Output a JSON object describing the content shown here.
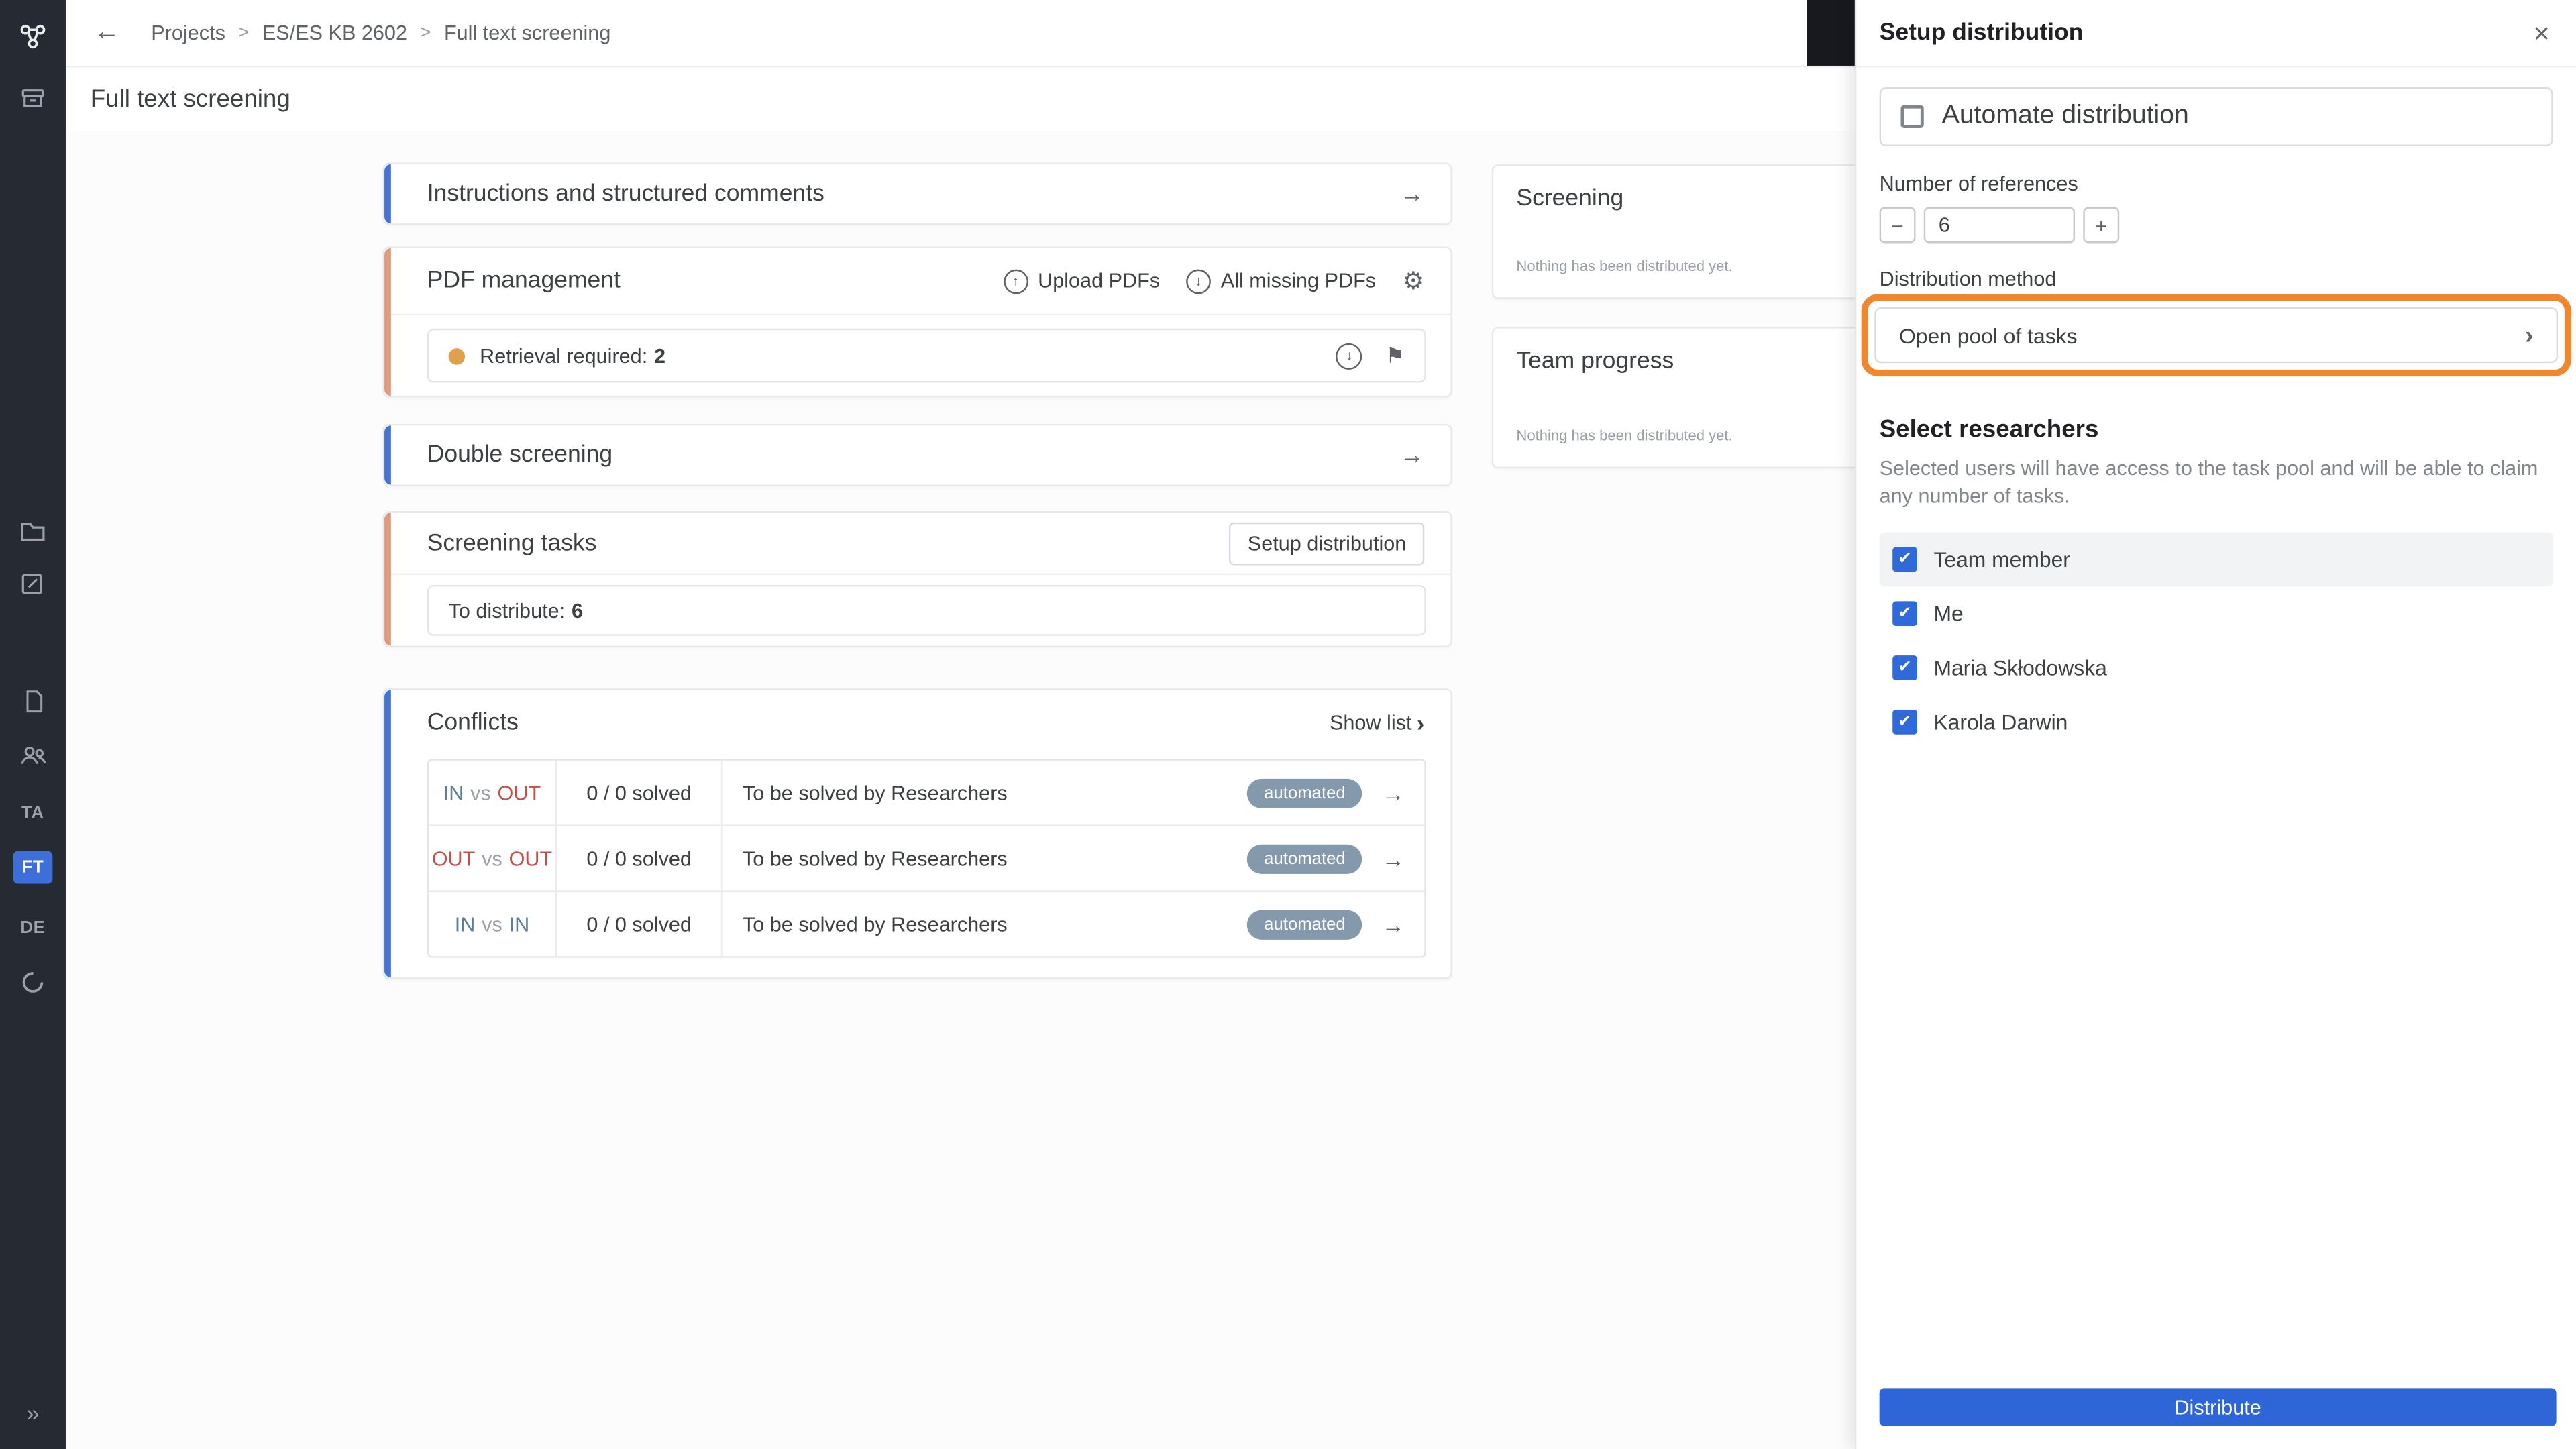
{
  "ui": {
    "back_arrow": "←",
    "arrow": "→",
    "chevron": "›",
    "crumb_sep": ">",
    "check": "✔",
    "up": "↑",
    "down": "↓",
    "gear": "⚙",
    "flag": "⚑",
    "close": "×",
    "minus": "−",
    "plus": "+",
    "expand": "»"
  },
  "sidebar": {
    "icons": [
      "app-logo",
      "archive-icon",
      "folder-icon",
      "edit-icon",
      "document-icon",
      "team-icon",
      "sync-icon",
      "expand-icon"
    ],
    "labels": {
      "ta": "TA",
      "ft": "FT",
      "de": "DE"
    }
  },
  "topbar": {
    "breadcrumb": [
      "Projects",
      "ES/ES KB 2602",
      "Full text screening"
    ]
  },
  "page": {
    "title": "Full text screening"
  },
  "cards": {
    "instructions": {
      "title": "Instructions and structured comments"
    },
    "pdf_management": {
      "title": "PDF management",
      "upload_label": "Upload PDFs",
      "missing_label": "All missing PDFs",
      "retrieval_label": "Retrieval required:",
      "retrieval_count": "2"
    },
    "double_screening": {
      "title": "Double screening"
    },
    "screening_tasks": {
      "title": "Screening tasks",
      "setup_button": "Setup distribution",
      "to_distribute_label": "To distribute:",
      "to_distribute_count": "6"
    },
    "conflicts": {
      "title": "Conflicts",
      "show_list": "Show list",
      "rows": [
        {
          "left": "IN",
          "vs": "vs",
          "right": "OUT",
          "solved": "0 / 0 solved",
          "by": "To be solved by Researchers",
          "badge": "automated"
        },
        {
          "left": "OUT",
          "vs": "vs",
          "right": "OUT",
          "solved": "0 / 0 solved",
          "by": "To be solved by Researchers",
          "badge": "automated"
        },
        {
          "left": "IN",
          "vs": "vs",
          "right": "IN",
          "solved": "0 / 0 solved",
          "by": "To be solved by Researchers",
          "badge": "automated"
        }
      ]
    }
  },
  "side_panels": {
    "screening": {
      "title": "Screening",
      "empty": "Nothing has been distributed yet."
    },
    "team_progress": {
      "title": "Team progress",
      "empty": "Nothing has been distributed yet."
    }
  },
  "drawer": {
    "title": "Setup distribution",
    "automate_label": "Automate distribution",
    "references_label": "Number of references",
    "references_value": "6",
    "method_label": "Distribution method",
    "method_value": "Open pool of tasks",
    "researchers_title": "Select researchers",
    "researchers_desc": "Selected users will have access to the task pool and will be able to claim any number of tasks.",
    "researchers": [
      {
        "name": "Team member",
        "checked": true
      },
      {
        "name": "Me",
        "checked": true
      },
      {
        "name": "Maria Skłodowska",
        "checked": true
      },
      {
        "name": "Karola Darwin",
        "checked": true
      }
    ],
    "distribute_button": "Distribute"
  },
  "colors": {
    "accent_blue": "#4472d6",
    "accent_orange": "#e09a7e",
    "highlight_orange": "#f0862e",
    "primary_button": "#2e66d8",
    "badge": "#8599ad",
    "in_text": "#5c7e99",
    "out_text": "#c0504a",
    "retrieval_dot": "#dfa14b",
    "sidebar_bg": "#252a33",
    "active_tab": "#3e6fd9"
  }
}
